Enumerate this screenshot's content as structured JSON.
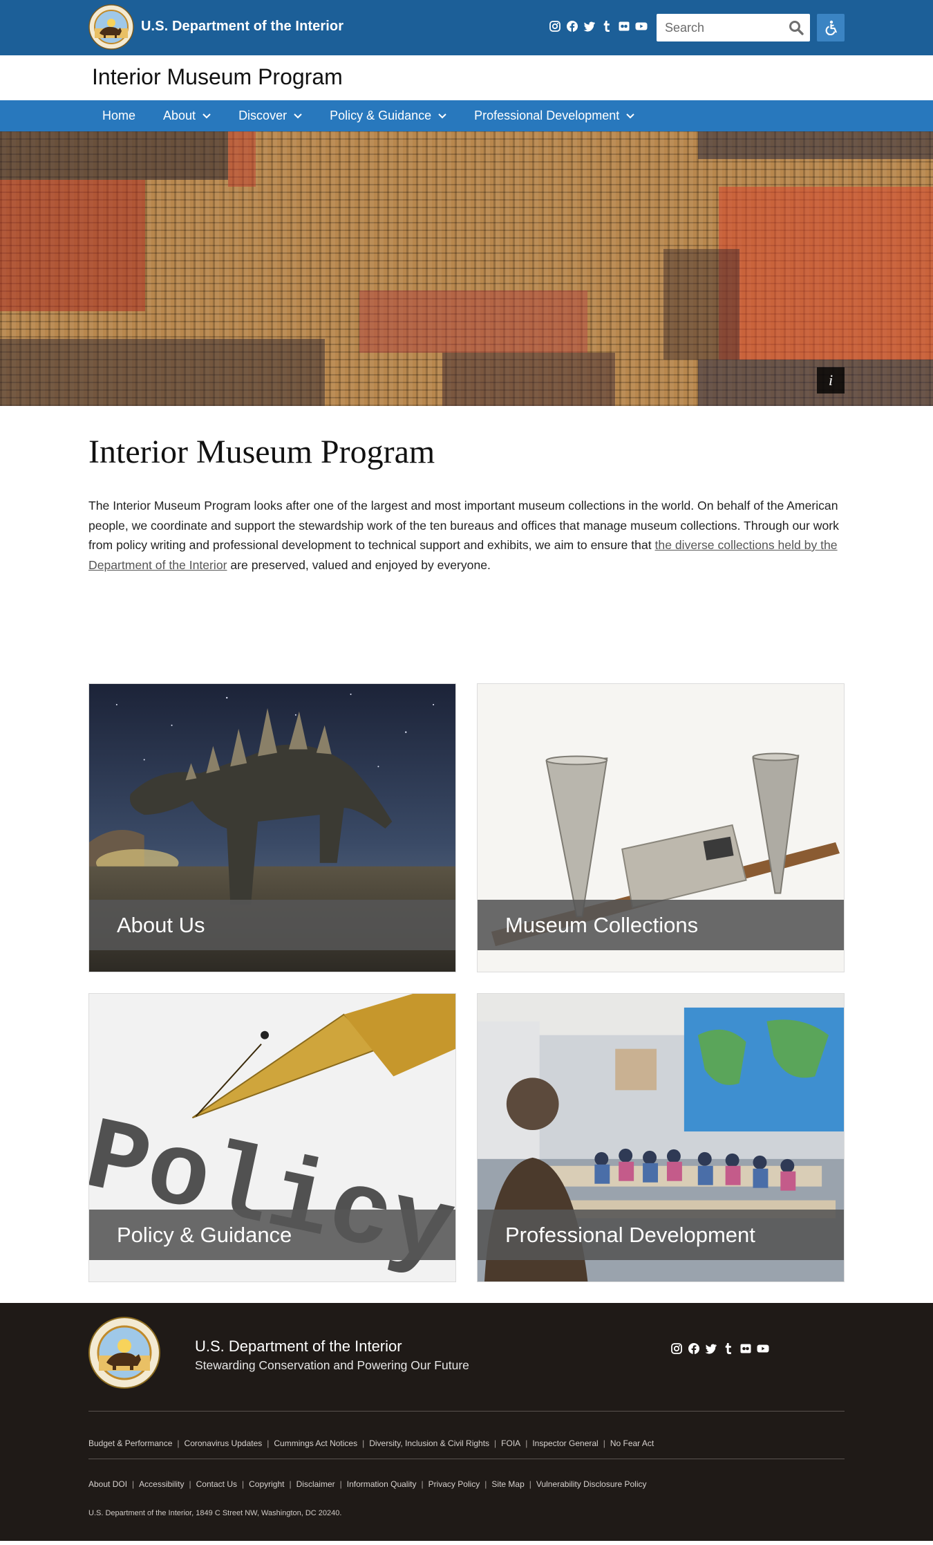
{
  "header": {
    "agency_name": "U.S. Department of the Interior",
    "seal_text": "U.S. Department of the Interior — March 3, 1849",
    "social_icons": [
      "instagram-icon",
      "facebook-icon",
      "twitter-icon",
      "tumblr-icon",
      "flickr-icon",
      "youtube-icon"
    ],
    "search": {
      "placeholder": "Search",
      "value": ""
    },
    "accessibility_icon": "accessibility-icon",
    "colors": {
      "top_bar": "#1c5f98",
      "nav_bar": "#2878bd"
    }
  },
  "site": {
    "title": "Interior Museum Program"
  },
  "nav": {
    "items": [
      {
        "label": "Home",
        "dropdown": false
      },
      {
        "label": "About",
        "dropdown": true
      },
      {
        "label": "Discover",
        "dropdown": true
      },
      {
        "label": "Policy & Guidance",
        "dropdown": true
      },
      {
        "label": "Professional Development",
        "dropdown": true
      }
    ]
  },
  "hero": {
    "info_label": "i"
  },
  "main": {
    "heading": "Interior Museum Program",
    "intro_before_link": "The Interior Museum Program looks after one of the largest and most important museum collections in the world. On behalf of the American people, we coordinate and support the stewardship work of the ten bureaus and offices that manage museum collections. Through our work from policy writing and professional development to technical support and exhibits, we aim to ensure that ",
    "intro_link": "the diverse collections held by the Department of the Interior",
    "intro_after_link": " are preserved, valued and enjoyed by everyone."
  },
  "cards": [
    {
      "label": "About Us"
    },
    {
      "label": "Museum Collections"
    },
    {
      "label": "Policy & Guidance",
      "image_word": "Policy"
    },
    {
      "label": "Professional Development"
    }
  ],
  "footer": {
    "agency_name": "U.S. Department of the Interior",
    "tagline": "Stewarding Conservation and Powering Our Future",
    "seal_text": "U.S. Department of the Interior — March 3, 1849",
    "social_icons": [
      "instagram-icon",
      "facebook-icon",
      "twitter-icon",
      "tumblr-icon",
      "flickr-icon",
      "youtube-icon"
    ],
    "links_row1": [
      "Budget & Performance",
      "Coronavirus Updates",
      "Cummings Act Notices",
      "Diversity, Inclusion & Civil Rights",
      "FOIA",
      "Inspector General",
      "No Fear Act"
    ],
    "links_row2": [
      "About DOI",
      "Accessibility",
      "Contact Us",
      "Copyright",
      "Disclaimer",
      "Information Quality",
      "Privacy Policy",
      "Site Map",
      "Vulnerability Disclosure Policy"
    ],
    "address": "U.S. Department of the Interior, 1849 C Street NW, Washington, DC 20240."
  }
}
